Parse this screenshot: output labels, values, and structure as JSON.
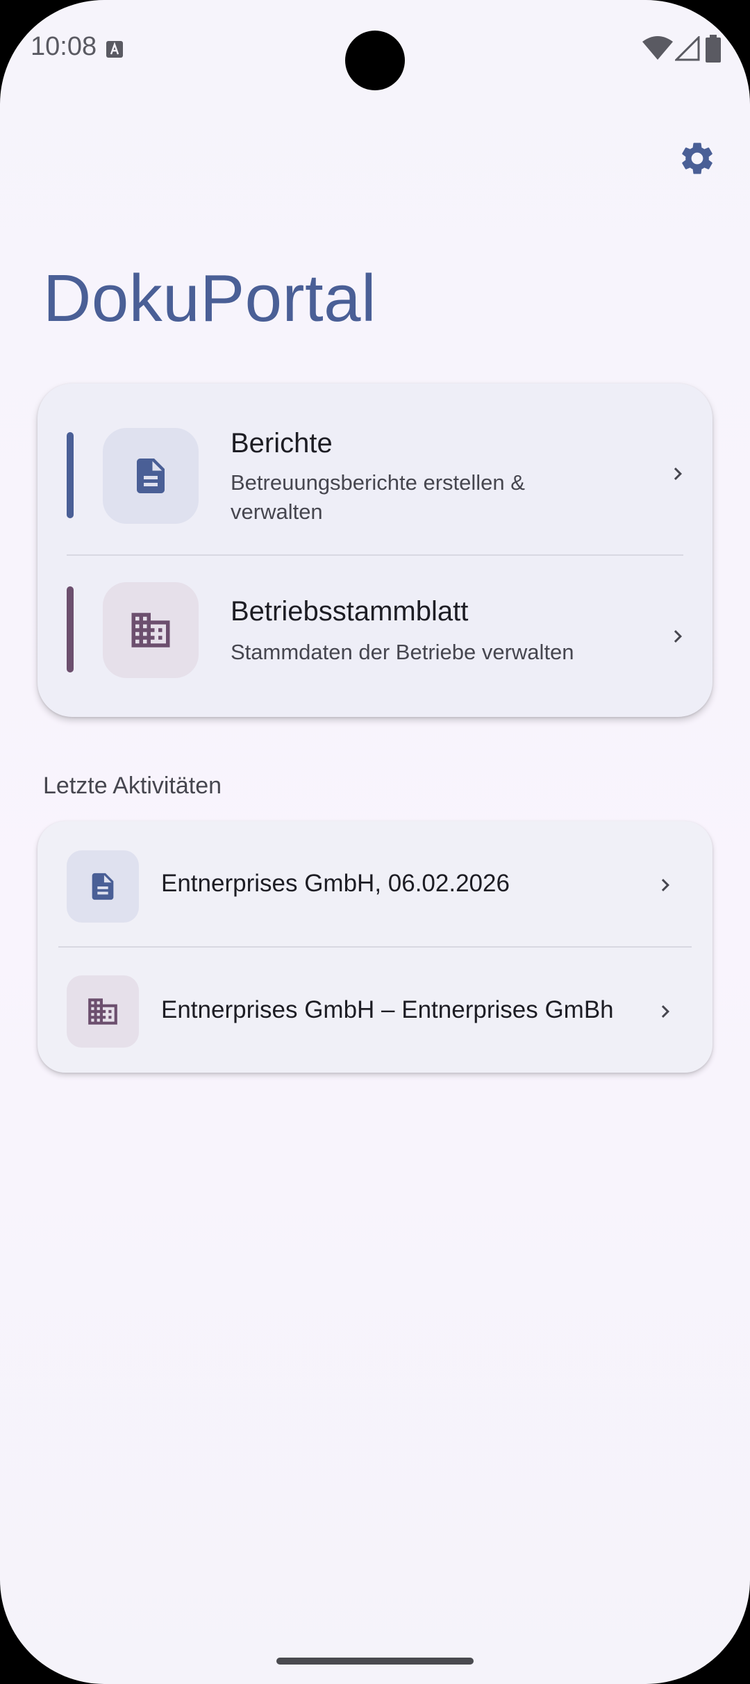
{
  "status_bar": {
    "time": "10:08"
  },
  "app": {
    "title": "DokuPortal"
  },
  "main_card": {
    "items": [
      {
        "title": "Berichte",
        "subtitle": "Betreuungsberichte erstellen & verwalten",
        "icon": "document-icon",
        "accent_color": "#4a5f96"
      },
      {
        "title": "Betriebsstammblatt",
        "subtitle": "Stammdaten der Betriebe verwalten",
        "icon": "building-icon",
        "accent_color": "#6c4f6e"
      }
    ]
  },
  "recent": {
    "section_title": "Letzte Aktivitäten",
    "items": [
      {
        "label": "Entnerprises GmbH, 06.02.2026",
        "icon": "document-icon"
      },
      {
        "label": "Entnerprises GmbH – Entnerprises GmBh",
        "icon": "building-icon"
      }
    ]
  },
  "colors": {
    "primary": "#4a5f96",
    "secondary": "#6c4f6e",
    "background": "#f6f4fb"
  }
}
